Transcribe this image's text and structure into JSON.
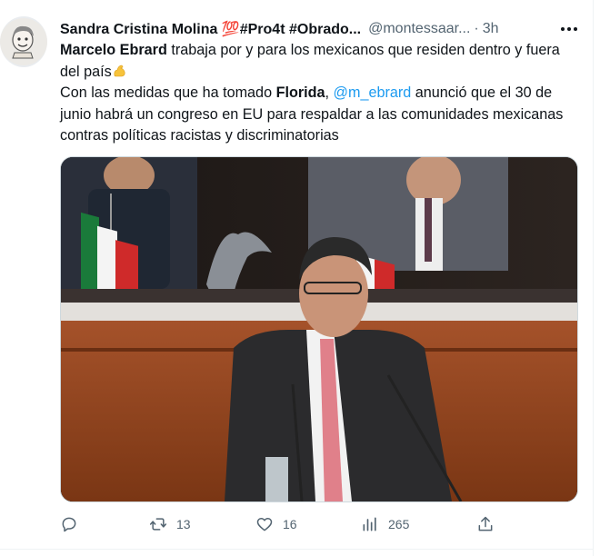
{
  "tweet": {
    "display_name": "Sandra Cristina Molina 💯#Pro4t #Obrado...",
    "handle": "@montessaar...",
    "separator": "·",
    "time": "3h",
    "line1_bold": "Marcelo Ebrard",
    "line1_rest": " trabaja por y para los mexicanos que residen dentro y fuera del país",
    "line2_start": "Con las medidas que ha tomado ",
    "line2_bold": "Florida",
    "line2_comma": ", ",
    "mention": "@m_ebrard",
    "line2_rest": " anunció que el 30 de junio habrá un congreso en EU para respaldar a las comunidades mexicanas contras políticas racistas y discriminatorias"
  },
  "actions": {
    "reply_icon": "reply-icon",
    "retweet_count": "13",
    "like_count": "16",
    "views_count": "265",
    "share_icon": "share-icon"
  },
  "colors": {
    "link": "#1d9bf0",
    "muted": "#536471",
    "text": "#0f1419"
  }
}
